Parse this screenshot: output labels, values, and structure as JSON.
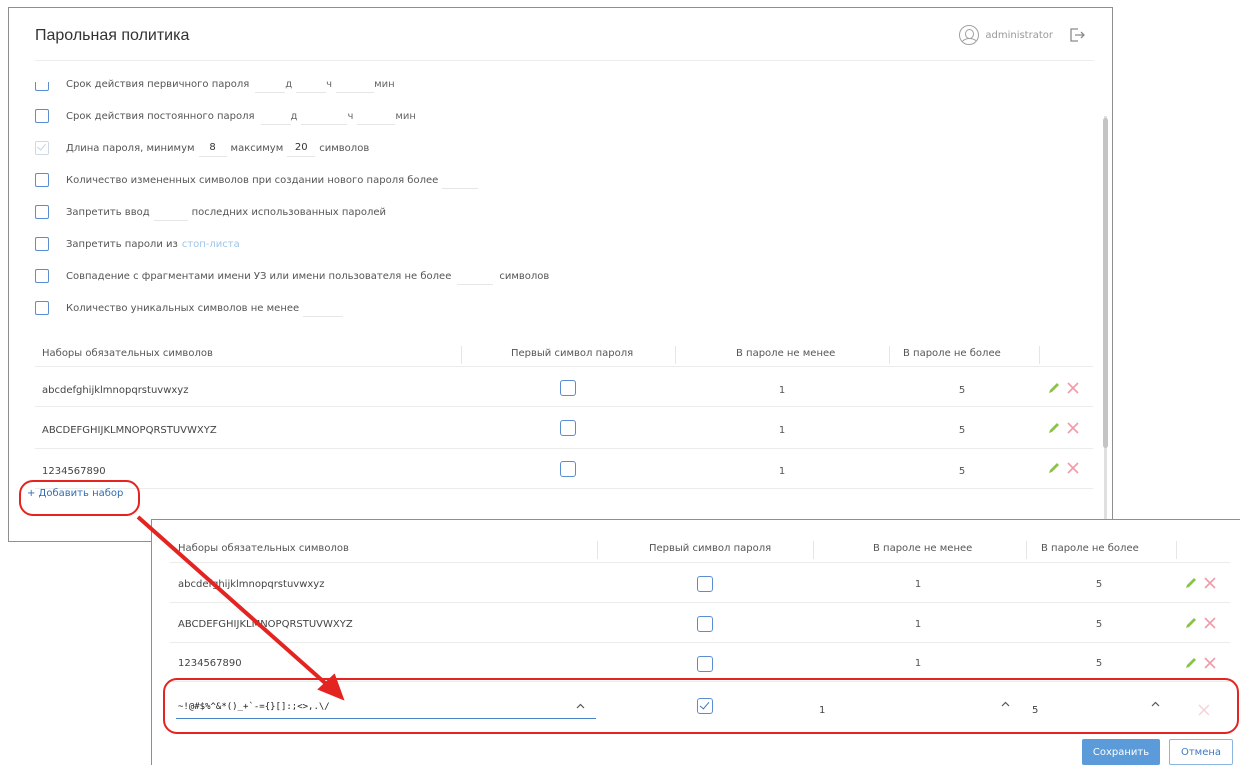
{
  "header": {
    "title": "Парольная политика",
    "username": "administrator"
  },
  "policy": {
    "initial_expiry": {
      "label": "Срок действия первичного пароля",
      "d": "д",
      "h": "ч",
      "m": "мин"
    },
    "permanent_expiry": {
      "label": "Срок действия постоянного пароля",
      "d": "д",
      "h": "ч",
      "m": "мин"
    },
    "length": {
      "label_min": "Длина пароля, минимум",
      "min": "8",
      "label_max": "максимум",
      "max": "20",
      "suffix": "символов"
    },
    "changed_chars": {
      "label": "Количество измененных символов при создании нового пароля более"
    },
    "forbid_reuse": {
      "prefix": "Запретить ввод",
      "suffix": "последних использованных паролей"
    },
    "stoplist": {
      "prefix": "Запретить пароли из",
      "link": "стоп-листа"
    },
    "name_match": {
      "prefix": "Совпадение с фрагментами имени УЗ или имени пользователя не более",
      "suffix": "символов"
    },
    "unique_chars": {
      "label": "Количество уникальных символов не менее"
    }
  },
  "table": {
    "headers": [
      "Наборы обязательных символов",
      "Первый символ пароля",
      "В пароле не менее",
      "В пароле не более"
    ],
    "rows": [
      {
        "set": "abcdefghijklmnopqrstuvwxyz",
        "min": "1",
        "max": "5"
      },
      {
        "set": "ABCDEFGHIJKLMNOPQRSTUVWXYZ",
        "min": "1",
        "max": "5"
      },
      {
        "set": "1234567890",
        "min": "1",
        "max": "5"
      }
    ],
    "add_label": "+ Добавить набор"
  },
  "new_row": {
    "set": "~!@#$%^&*()_+`-={}[]:;<>,.\\/",
    "min": "1",
    "max": "5"
  },
  "buttons": {
    "save": "Сохранить",
    "cancel": "Отмена"
  },
  "colors": {
    "highlight": "#e32421",
    "accent": "#5b9bd9",
    "link": "#2f6db5"
  }
}
